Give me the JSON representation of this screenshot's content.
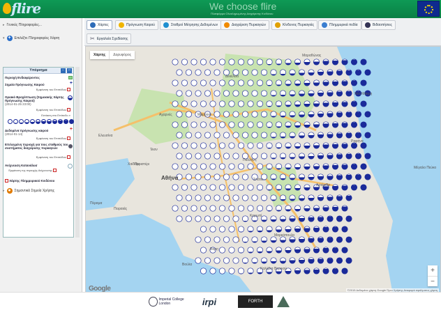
{
  "header": {
    "logo_text": "flire",
    "slogan": "We choose flire",
    "subslogan": "Πλατφόρμα Ολοκληρωμένης Διαχείρισης Κινδύνου"
  },
  "left_panel": {
    "accordion": [
      {
        "label": "Γενικές Πληροφορίες..."
      },
      {
        "label": "Επιλέξτε Πληροφορίες Χάρτη"
      },
      {
        "label": "Σημαντικά Σημεία Χρήσης"
      }
    ],
    "legend": {
      "title": "Υπόμνημα",
      "sections": [
        {
          "title": "Περιοχή Ενδιαφέροντος",
          "sub": ""
        },
        {
          "title": "Σημεία Πρόγνωσης Καιρού",
          "sub": "Εμφάνιση του Επιπέδου"
        },
        {
          "title": "Οριακό Βροχόπτωση (Σημειακής Χάρτης Πρόγνωσης Καιρού)",
          "sub": "(2014-01-25 23:00)",
          "extra": "Εμφάνιση του Επιπέδου",
          "extra2": "Εστίαση στο Επίπεδο"
        },
        {
          "title": "Δεδομένα πρόγνωσης καιρού",
          "sub": "(2014-01-14)",
          "extra": "Εμφάνιση του Επιπέδου"
        },
        {
          "title": "Επιλεγμένη περιοχή για τους σταθμούς του συστήματος διαχείρισης πυρκαγιών",
          "sub": "Εμφάνιση του Επιπέδου"
        },
        {
          "title": "Ανίχνευση Κατανάλυσ",
          "sub": "Εμφάνιση της περιοχής Ανίχνευσης"
        },
        {
          "title": "Χάρτης Πλημμυρικού Κινδύνου",
          "sub": ""
        }
      ]
    }
  },
  "toolbar": {
    "tabs": [
      {
        "label": "Χάρτες",
        "color": "#2d6bb8"
      },
      {
        "label": "Πρόγνωση Καιρού",
        "color": "#f0b400"
      },
      {
        "label": "Σταθμοί Μέτρησης Δεδομένων",
        "color": "#1f8fd0"
      },
      {
        "label": "Διαχείριση Πυρκαγιών",
        "color": "#f08a00"
      },
      {
        "label": "Κίνδυνος Πυρκαγιάς",
        "color": "#e0a000"
      },
      {
        "label": "Πλημμυρικά πεδία",
        "color": "#3a7ed0"
      },
      {
        "label": "Βιδαοπήσεις",
        "color": "#335"
      }
    ],
    "tools_label": "Εργαλεία Σχεδίασης"
  },
  "map": {
    "type_options": {
      "map": "Χάρτης",
      "satellite": "Δορυφόρος"
    },
    "zoom_in": "+",
    "zoom_out": "−",
    "google_label": "Google",
    "attribution": "©2015 Δεδομένα χάρτη Google   Όροι Χρήσης   Αναφορά σφάλματος χάρτη",
    "places": {
      "athens": "Αθήνα",
      "piraeus": "Πειραιάς",
      "peristeri": "Περιστέρι",
      "acharnes": "Αχαρνές",
      "marousi": "Μαρούσι",
      "spata": "Σπάτα",
      "koropi": "Κορωπί",
      "vari": "Βάρη",
      "voula": "Βούλα",
      "nea_makri": "Νέα Μάκρη",
      "rafina": "Ραφήνα",
      "marathonas": "Μαραθώνας",
      "megalo_pefko": "Μέγαλο Πεύκο",
      "perama": "Πέραμα",
      "chaidari": "Χαϊδάρι",
      "kalyvia": "Καλύβια Θορικού",
      "markopoulo": "Μαρκόπουλο",
      "pallini": "Παλλήνη",
      "ilion": "Ίλιον",
      "elefsina": "Ελευσίνα",
      "dekeleia": "Δεκέλεια",
      "artemida": "Αρτέμιδα"
    }
  },
  "footer": {
    "logos": [
      "Imperial College London",
      "irpi",
      "FORTH",
      "Λογότυπο"
    ]
  }
}
